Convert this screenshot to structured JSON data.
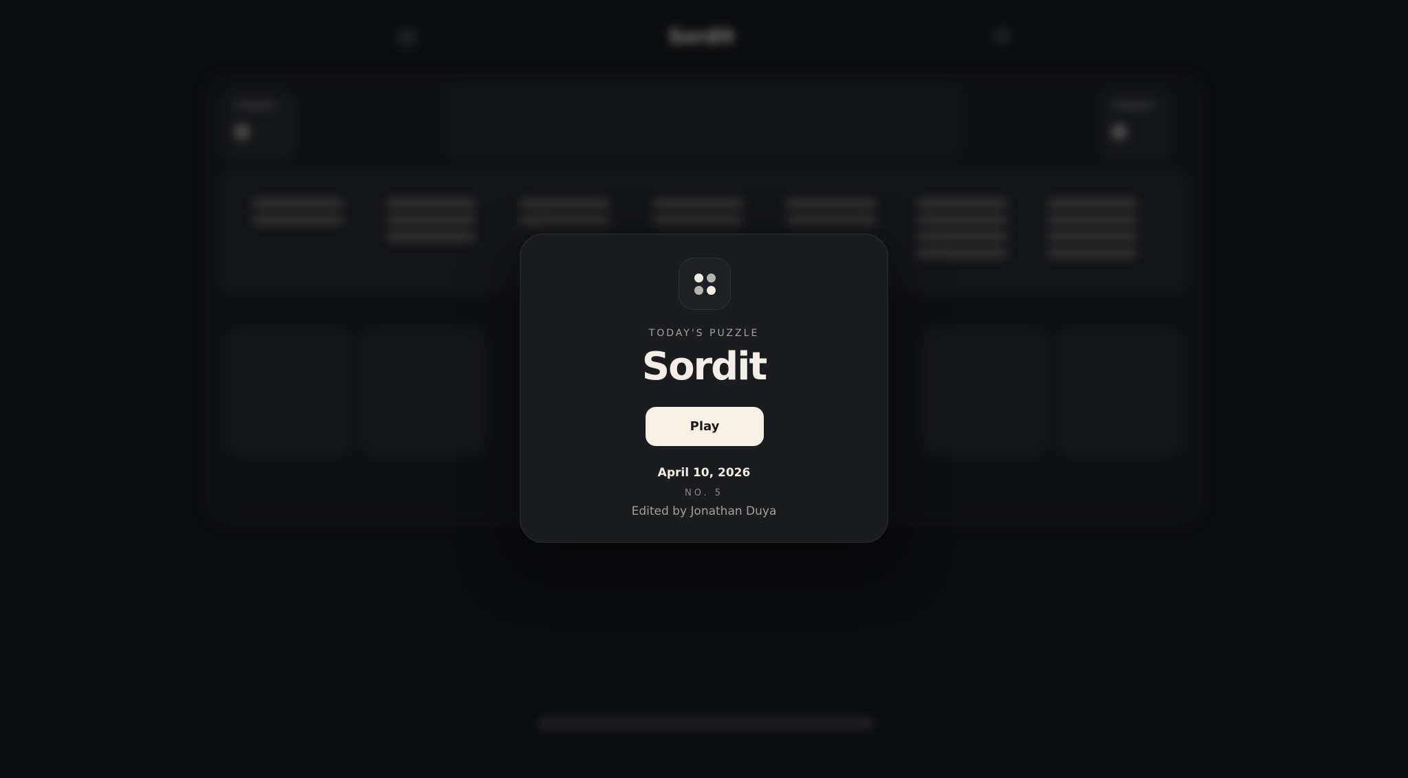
{
  "modal": {
    "eyebrow": "TODAY'S PUZZLE",
    "title": "Sordit",
    "play_label": "Play",
    "date": "April 10, 2026",
    "number": "NO. 5",
    "editor": "Edited by Jonathan Duya",
    "icon": "four-dots-grid-icon"
  },
  "colors": {
    "background": "#0b0c0e",
    "card": "#1b1c1f",
    "play_button": "#f6f0e5",
    "title_text": "#f4efe6",
    "dot_light": "#f1ece3",
    "dot_muted": "#b9b5ae"
  }
}
